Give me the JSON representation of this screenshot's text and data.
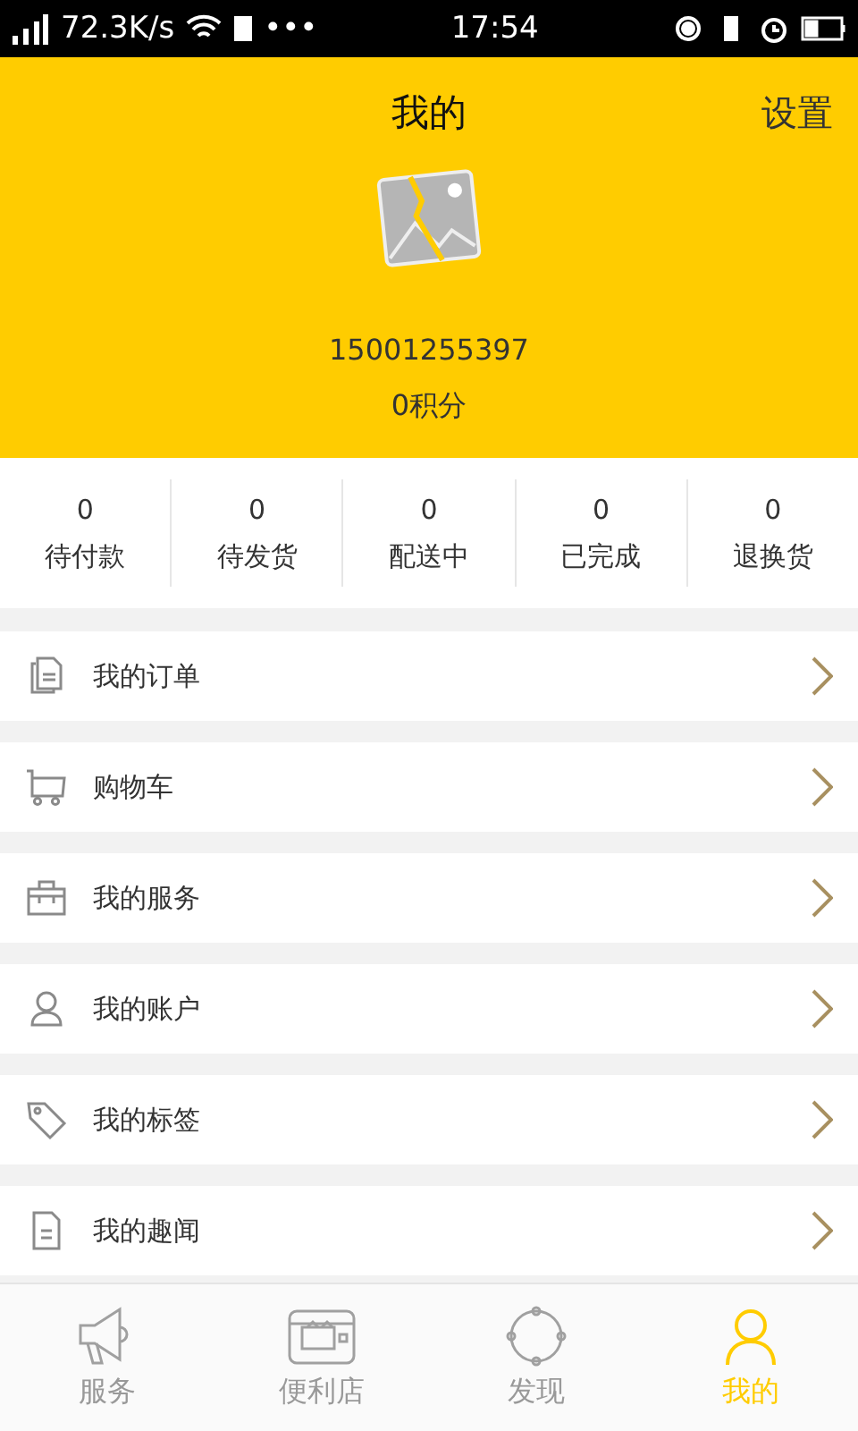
{
  "status_bar": {
    "speed": "72.3K/s",
    "more": "•••",
    "time": "17:54"
  },
  "header": {
    "title": "我的",
    "settings": "设置",
    "phone": "15001255397",
    "points": "0积分"
  },
  "stats": [
    {
      "count": "0",
      "label": "待付款"
    },
    {
      "count": "0",
      "label": "待发货"
    },
    {
      "count": "0",
      "label": "配送中"
    },
    {
      "count": "0",
      "label": "已完成"
    },
    {
      "count": "0",
      "label": "退换货"
    }
  ],
  "menu": [
    {
      "kind": "orders",
      "label": "我的订单"
    },
    {
      "kind": "cart",
      "label": "购物车"
    },
    {
      "kind": "service",
      "label": "我的服务"
    },
    {
      "kind": "account",
      "label": "我的账户"
    },
    {
      "kind": "tags",
      "label": "我的标签"
    },
    {
      "kind": "news",
      "label": "我的趣闻"
    }
  ],
  "tab_bar": [
    {
      "kind": "megaphone",
      "label": "服务",
      "selected": false
    },
    {
      "kind": "store",
      "label": "便利店",
      "selected": false
    },
    {
      "kind": "discover",
      "label": "发现",
      "selected": false
    },
    {
      "kind": "person",
      "label": "我的",
      "selected": true
    }
  ]
}
